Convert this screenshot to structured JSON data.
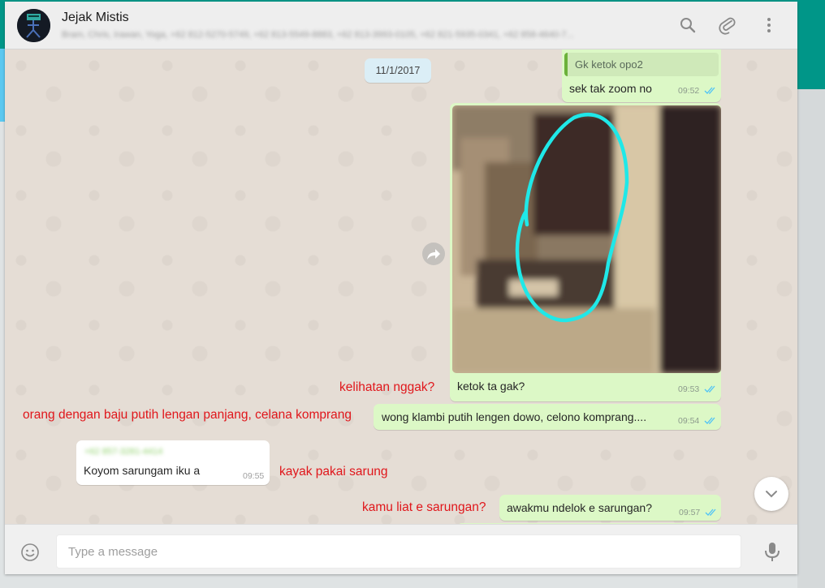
{
  "header": {
    "title": "Jejak Mistis",
    "subtitle": "Bram, Chris, Irawan, Yoga, +62 812-5270-5749, +62 813-5549-8883, +62 813-3993-0105, +62 821-5935-0341, +62 858-4640-7..."
  },
  "date_chip": "11/1/2017",
  "messages": {
    "quote_text": "Gk ketok opo2",
    "m1": {
      "text": "sek tak zoom no",
      "time": "09:52"
    },
    "m2": {
      "text": "ketok ta gak?",
      "time": "09:53"
    },
    "m3": {
      "text": "wong klambi putih lengen dowo, celono komprang....",
      "time": "09:54"
    },
    "m4": {
      "sender": "+62 857-3281-4414",
      "text": "Koyom sarungam iku a",
      "time": "09:55"
    },
    "m5": {
      "text": "awakmu ndelok e sarungan?",
      "time": "09:57"
    }
  },
  "annotations": {
    "a1": "kelihatan nggak?",
    "a2": "orang dengan baju putih lengan panjang, celana komprang",
    "a3": "kayak pakai sarung",
    "a4": "kamu liat e sarungan?"
  },
  "footer": {
    "placeholder": "Type a message"
  },
  "colors": {
    "outgoing_bubble": "#dcf8c6",
    "incoming_bubble": "#ffffff",
    "annotation_red": "#e0161b",
    "ticks_blue": "#4fc3f7",
    "header_band": "#009688",
    "circle_highlight": "#1fe8e8"
  },
  "icons": [
    "search-icon",
    "paperclip-icon",
    "kebab-menu-icon",
    "forward-icon",
    "chevron-down-icon",
    "emoji-icon",
    "microphone-icon",
    "double-check-icon"
  ]
}
